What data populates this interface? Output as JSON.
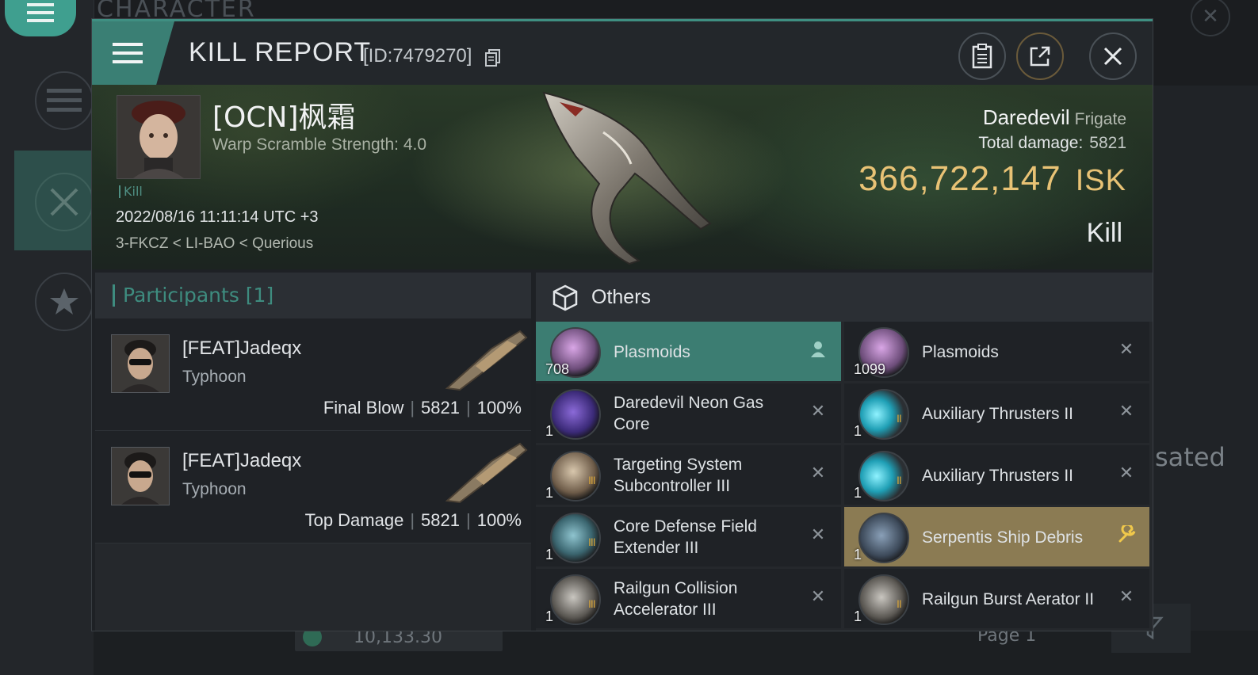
{
  "background": {
    "title": "CHARACTER",
    "right_fragment": "sated",
    "bottom_value": "10,133.30",
    "bottom_page": "Page 1"
  },
  "header": {
    "title": "KILL REPORT",
    "id_text": "[ID:7479270]"
  },
  "victim": {
    "name": "[OCN]枫霜",
    "warp_scramble": "Warp Scramble Strength: 4.0",
    "tag": "Kill",
    "datetime": "2022/08/16 11:11:14 UTC +3",
    "location": "3-FKCZ < LI-BAO < Querious",
    "ship": "Daredevil",
    "ship_class": "Frigate",
    "total_damage_label": "Total damage:",
    "total_damage": "5821",
    "isk_value": "366,722,147",
    "isk_unit": "ISK",
    "result": "Kill"
  },
  "participants": {
    "title": "Participants [1]",
    "rows": [
      {
        "name": "[FEAT]Jadeqx",
        "ship": "Typhoon",
        "role": "Final Blow",
        "damage": "5821",
        "percent": "100%"
      },
      {
        "name": "[FEAT]Jadeqx",
        "ship": "Typhoon",
        "role": "Top Damage",
        "damage": "5821",
        "percent": "100%"
      }
    ]
  },
  "items": {
    "title": "Others",
    "cells": [
      {
        "name": "Plasmoids",
        "qty": "708",
        "meta": "",
        "state": "person",
        "icon": "plasmoid-icon"
      },
      {
        "name": "Plasmoids",
        "qty": "1099",
        "meta": "",
        "state": "destroyed",
        "icon": "plasmoid-icon"
      },
      {
        "name": "Daredevil Neon Gas Core",
        "qty": "1",
        "meta": "",
        "state": "destroyed",
        "icon": "gas-core-icon"
      },
      {
        "name": "Auxiliary Thrusters II",
        "qty": "1",
        "meta": "II",
        "state": "destroyed",
        "icon": "thruster-icon"
      },
      {
        "name": "Targeting System Subcontroller III",
        "qty": "1",
        "meta": "III",
        "state": "destroyed",
        "icon": "rig-icon"
      },
      {
        "name": "Auxiliary Thrusters II",
        "qty": "1",
        "meta": "II",
        "state": "destroyed",
        "icon": "thruster-icon"
      },
      {
        "name": "Core Defense Field Extender III",
        "qty": "1",
        "meta": "III",
        "state": "destroyed",
        "icon": "shield-rig-icon"
      },
      {
        "name": "Serpentis Ship Debris",
        "qty": "1",
        "meta": "",
        "state": "wrench",
        "icon": "debris-icon"
      },
      {
        "name": "Railgun Collision Accelerator III",
        "qty": "1",
        "meta": "III",
        "state": "destroyed",
        "icon": "railgun-rig-icon"
      },
      {
        "name": "Railgun Burst Aerator II",
        "qty": "1",
        "meta": "II",
        "state": "destroyed",
        "icon": "railgun-rig-icon"
      }
    ]
  },
  "colors": {
    "accent_teal": "#3c7d72",
    "isk_gold": "#e8c275",
    "highlight_gold": "#8b7b53"
  }
}
